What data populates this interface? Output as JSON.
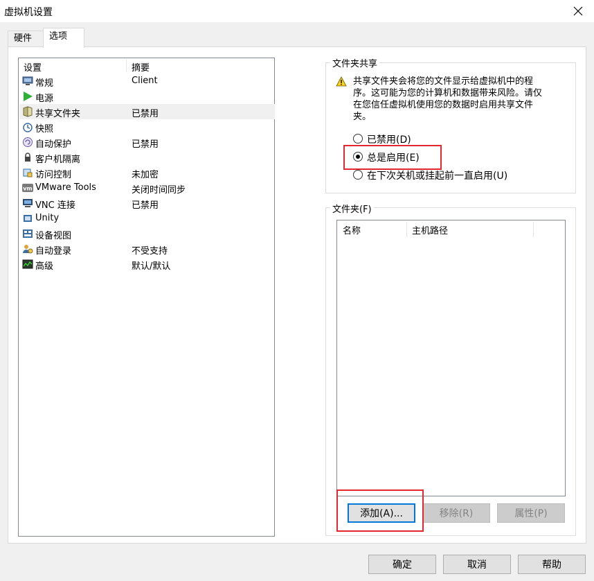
{
  "window": {
    "title": "虚拟机设置"
  },
  "tabs": [
    {
      "label": "硬件"
    },
    {
      "label": "选项"
    }
  ],
  "settings_list": {
    "headers": {
      "setting": "设置",
      "summary": "摘要"
    },
    "rows": [
      {
        "label": "常规",
        "summary": "Client",
        "icon": "monitor-icon"
      },
      {
        "label": "电源",
        "summary": "",
        "icon": "play-icon"
      },
      {
        "label": "共享文件夹",
        "summary": "已禁用",
        "icon": "shared-folder-icon"
      },
      {
        "label": "快照",
        "summary": "",
        "icon": "snapshot-icon"
      },
      {
        "label": "自动保护",
        "summary": "已禁用",
        "icon": "autoprotect-icon"
      },
      {
        "label": "客户机隔离",
        "summary": "",
        "icon": "lock-icon"
      },
      {
        "label": "访问控制",
        "summary": "未加密",
        "icon": "access-control-icon"
      },
      {
        "label": "VMware Tools",
        "summary": "关闭时间同步",
        "icon": "vm-icon"
      },
      {
        "label": "VNC 连接",
        "summary": "已禁用",
        "icon": "vnc-icon"
      },
      {
        "label": "Unity",
        "summary": "",
        "icon": "unity-icon"
      },
      {
        "label": "设备视图",
        "summary": "",
        "icon": "device-view-icon"
      },
      {
        "label": "自动登录",
        "summary": "不受支持",
        "icon": "autologin-icon"
      },
      {
        "label": "高级",
        "summary": "默认/默认",
        "icon": "advanced-icon"
      }
    ]
  },
  "sharing": {
    "title": "文件夹共享",
    "warning": "共享文件夹会将您的文件显示给虚拟机中的程序。这可能为您的计算机和数据带来风险。请仅在您信任虚拟机使用您的数据时启用共享文件夹。",
    "options": [
      {
        "label": "已禁用(D)",
        "checked": false
      },
      {
        "label": "总是启用(E)",
        "checked": true
      },
      {
        "label": "在下次关机或挂起前一直启用(U)",
        "checked": false
      }
    ]
  },
  "folders": {
    "title": "文件夹(F)",
    "columns": {
      "name": "名称",
      "host_path": "主机路径"
    },
    "add_button": "添加(A)...",
    "remove_button": "移除(R)",
    "properties_button": "属性(P)"
  },
  "footer": {
    "ok": "确定",
    "cancel": "取消",
    "help": "帮助"
  }
}
